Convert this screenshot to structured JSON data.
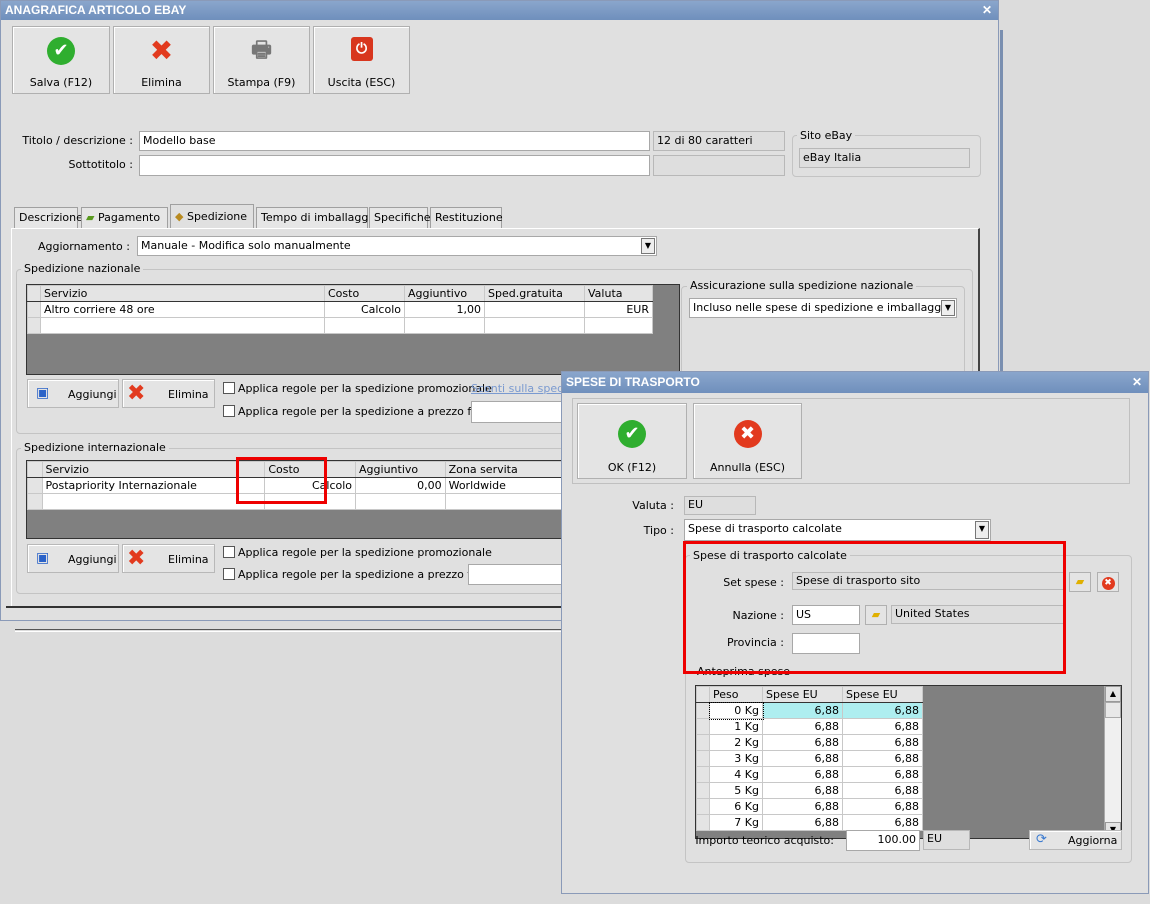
{
  "main": {
    "title": "ANAGRAFICA ARTICOLO EBAY",
    "toolbar": {
      "save": "Salva (F12)",
      "delete": "Elimina",
      "print": "Stampa (F9)",
      "exit": "Uscita (ESC)"
    },
    "title_label": "Titolo / descrizione :",
    "title_value": "Modello base",
    "title_counter": "12 di 80 caratteri",
    "subtitle_label": "Sottotitolo :",
    "subtitle_value": "",
    "site_legend": "Sito eBay",
    "site_value": "eBay Italia",
    "tabs": [
      "Descrizione",
      "Pagamento",
      "Spedizione",
      "Tempo di imballaggio",
      "Specifiche",
      "Restituzione"
    ],
    "update_label": "Aggiornamento :",
    "update_value": "Manuale - Modifica solo manualmente",
    "national": {
      "legend": "Spedizione nazionale",
      "columns": [
        "Servizio",
        "Costo",
        "Aggiuntivo",
        "Sped.gratuita",
        "Valuta"
      ],
      "rows": [
        [
          "Altro corriere 48 ore",
          "Calcolo",
          "1,00",
          "",
          "EUR"
        ]
      ],
      "insurance_legend": "Assicurazione sulla spedizione nazionale",
      "insurance_value": "Incluso nelle spese di spedizione e imballaggio",
      "add": "Aggiungi",
      "delete": "Elimina",
      "promo": "Applica regole per la spedizione promozionale",
      "fixed": "Applica regole per la spedizione a prezzo fisso",
      "discount_link": "Sconti sulla spedizio"
    },
    "international": {
      "legend": "Spedizione internazionale",
      "columns": [
        "Servizio",
        "Costo",
        "Aggiuntivo",
        "Zona servita"
      ],
      "rows": [
        [
          "Postapriority Internazionale",
          "Calcolo",
          "0,00",
          "Worldwide"
        ]
      ],
      "add": "Aggiungi",
      "delete": "Elimina",
      "promo": "Applica regole per la spedizione promozionale",
      "fixed": "Applica regole per la spedizione a prezzo fisso"
    }
  },
  "dialog": {
    "title": "SPESE DI TRASPORTO",
    "ok": "OK (F12)",
    "cancel": "Annulla (ESC)",
    "currency_label": "Valuta :",
    "currency_value": "EU",
    "type_label": "Tipo :",
    "type_value": "Spese di trasporto calcolate",
    "calc_legend": "Spese di trasporto calcolate",
    "set_label": "Set spese :",
    "set_value": "Spese di trasporto sito",
    "country_label": "Nazione :",
    "country_code": "US",
    "country_name": "United States",
    "province_label": "Provincia :",
    "province_value": "",
    "preview_legend": "Anteprima spese",
    "preview_columns": [
      "Peso",
      "Spese EU",
      "Spese EU"
    ],
    "preview_rows": [
      [
        "0 Kg",
        "6,88",
        "6,88"
      ],
      [
        "1 Kg",
        "6,88",
        "6,88"
      ],
      [
        "2 Kg",
        "6,88",
        "6,88"
      ],
      [
        "3 Kg",
        "6,88",
        "6,88"
      ],
      [
        "4 Kg",
        "6,88",
        "6,88"
      ],
      [
        "5 Kg",
        "6,88",
        "6,88"
      ],
      [
        "6 Kg",
        "6,88",
        "6,88"
      ],
      [
        "7 Kg",
        "6,88",
        "6,88"
      ]
    ],
    "amount_label": "Importo teorico acquisto:",
    "amount_value": "100.00",
    "amount_currency": "EU",
    "refresh": "Aggiorna"
  }
}
